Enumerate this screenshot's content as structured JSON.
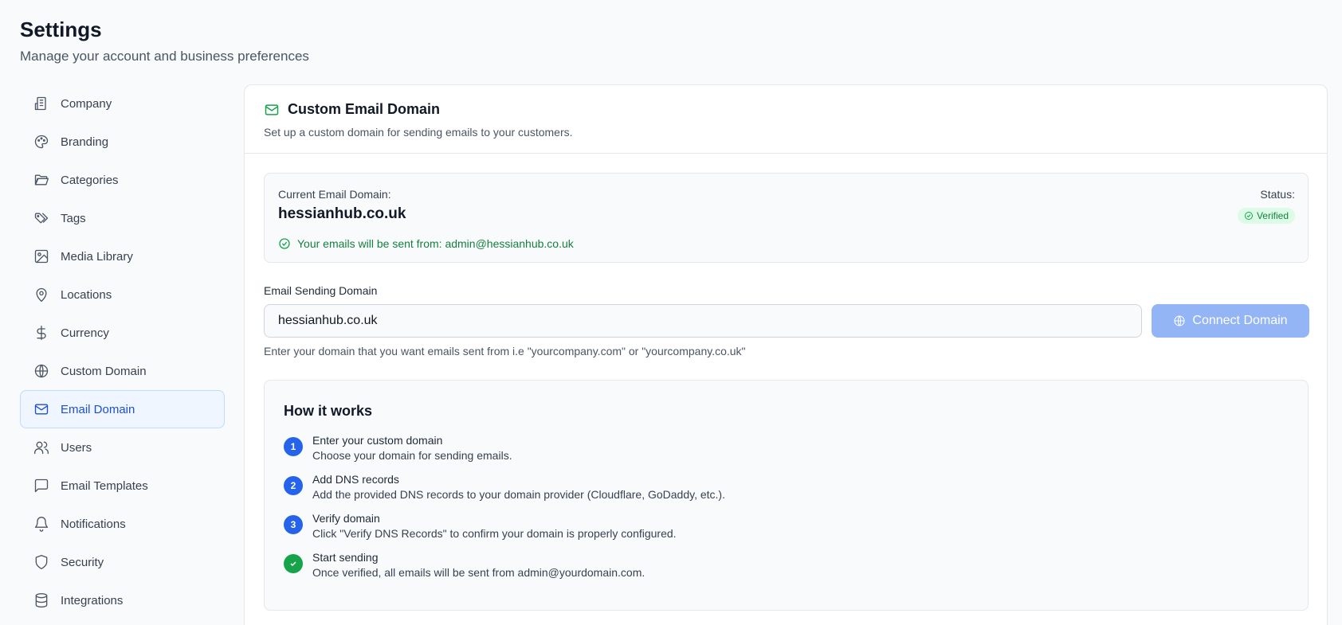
{
  "header": {
    "title": "Settings",
    "subtitle": "Manage your account and business preferences"
  },
  "sidebar": {
    "items": [
      {
        "label": "Company",
        "icon": "building-icon"
      },
      {
        "label": "Branding",
        "icon": "palette-icon"
      },
      {
        "label": "Categories",
        "icon": "folder-icon"
      },
      {
        "label": "Tags",
        "icon": "tags-icon"
      },
      {
        "label": "Media Library",
        "icon": "image-icon"
      },
      {
        "label": "Locations",
        "icon": "map-pin-icon"
      },
      {
        "label": "Currency",
        "icon": "dollar-icon"
      },
      {
        "label": "Custom Domain",
        "icon": "globe-icon"
      },
      {
        "label": "Email Domain",
        "icon": "mail-icon",
        "active": true
      },
      {
        "label": "Users",
        "icon": "users-icon"
      },
      {
        "label": "Email Templates",
        "icon": "message-icon"
      },
      {
        "label": "Notifications",
        "icon": "bell-icon"
      },
      {
        "label": "Security",
        "icon": "shield-icon"
      },
      {
        "label": "Integrations",
        "icon": "database-icon"
      }
    ]
  },
  "card": {
    "title": "Custom Email Domain",
    "subtitle": "Set up a custom domain for sending emails to your customers.",
    "current_label": "Current Email Domain:",
    "current_domain": "hessianhub.co.uk",
    "sent_from": "Your emails will be sent from: admin@hessianhub.co.uk",
    "status_label": "Status:",
    "status": "Verified",
    "accent": "#16a34a",
    "field_label": "Email Sending Domain",
    "field_value": "hessianhub.co.uk",
    "connect_label": "Connect Domain",
    "help": "Enter your domain that you want emails sent from i.e \"yourcompany.com\" or \"yourcompany.co.uk\""
  },
  "how": {
    "title": "How it works",
    "steps": [
      {
        "num": "1",
        "title": "Enter your custom domain",
        "desc": "Choose your domain for sending emails."
      },
      {
        "num": "2",
        "title": "Add DNS records",
        "desc": "Add the provided DNS records to your domain provider (Cloudflare, GoDaddy, etc.)."
      },
      {
        "num": "3",
        "title": "Verify domain",
        "desc": "Click \"Verify DNS Records\" to confirm your domain is properly configured."
      },
      {
        "num": "",
        "title": "Start sending",
        "desc": "Once verified, all emails will be sent from admin@yourdomain.com."
      }
    ]
  }
}
